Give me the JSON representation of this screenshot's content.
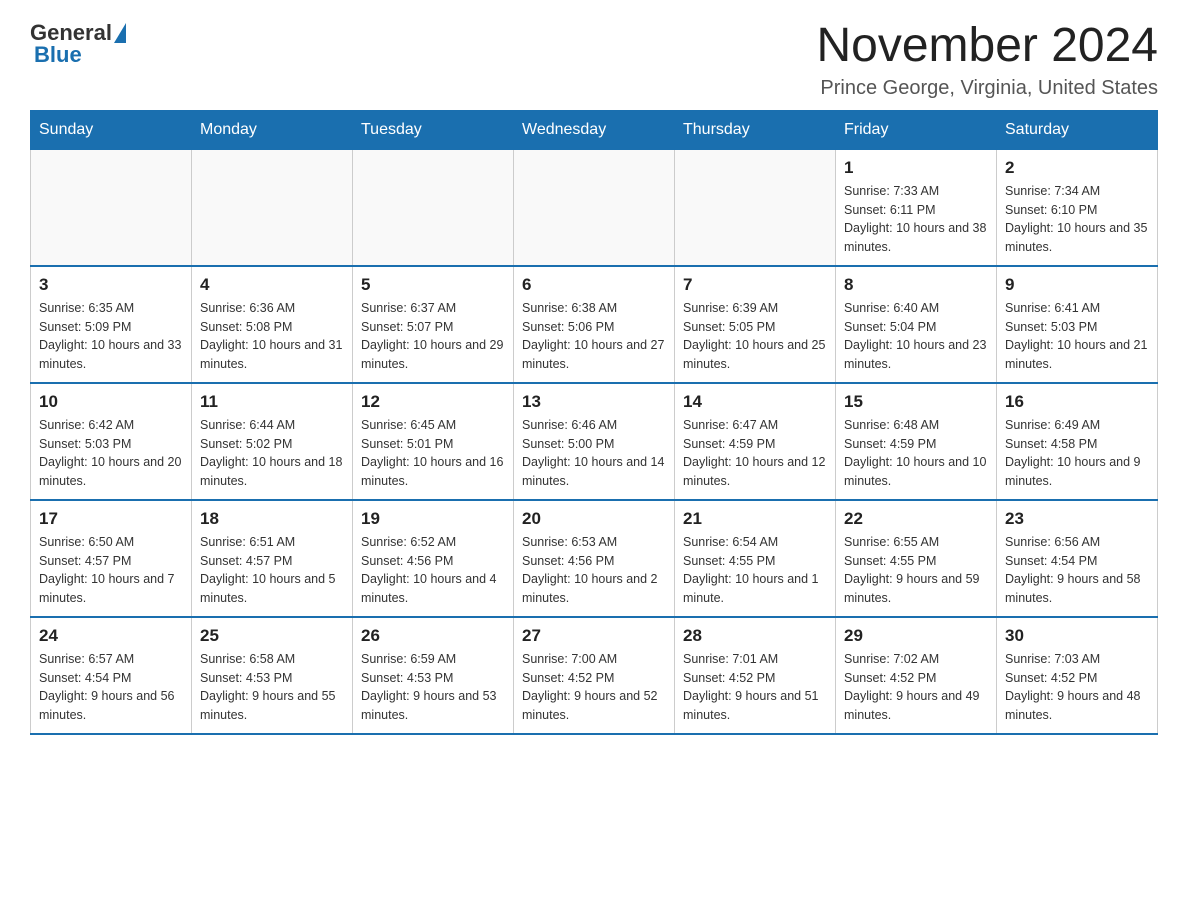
{
  "header": {
    "logo_general": "General",
    "logo_blue": "Blue",
    "month_title": "November 2024",
    "location": "Prince George, Virginia, United States"
  },
  "weekdays": [
    "Sunday",
    "Monday",
    "Tuesday",
    "Wednesday",
    "Thursday",
    "Friday",
    "Saturday"
  ],
  "weeks": [
    [
      {
        "day": "",
        "info": ""
      },
      {
        "day": "",
        "info": ""
      },
      {
        "day": "",
        "info": ""
      },
      {
        "day": "",
        "info": ""
      },
      {
        "day": "",
        "info": ""
      },
      {
        "day": "1",
        "info": "Sunrise: 7:33 AM\nSunset: 6:11 PM\nDaylight: 10 hours and 38 minutes."
      },
      {
        "day": "2",
        "info": "Sunrise: 7:34 AM\nSunset: 6:10 PM\nDaylight: 10 hours and 35 minutes."
      }
    ],
    [
      {
        "day": "3",
        "info": "Sunrise: 6:35 AM\nSunset: 5:09 PM\nDaylight: 10 hours and 33 minutes."
      },
      {
        "day": "4",
        "info": "Sunrise: 6:36 AM\nSunset: 5:08 PM\nDaylight: 10 hours and 31 minutes."
      },
      {
        "day": "5",
        "info": "Sunrise: 6:37 AM\nSunset: 5:07 PM\nDaylight: 10 hours and 29 minutes."
      },
      {
        "day": "6",
        "info": "Sunrise: 6:38 AM\nSunset: 5:06 PM\nDaylight: 10 hours and 27 minutes."
      },
      {
        "day": "7",
        "info": "Sunrise: 6:39 AM\nSunset: 5:05 PM\nDaylight: 10 hours and 25 minutes."
      },
      {
        "day": "8",
        "info": "Sunrise: 6:40 AM\nSunset: 5:04 PM\nDaylight: 10 hours and 23 minutes."
      },
      {
        "day": "9",
        "info": "Sunrise: 6:41 AM\nSunset: 5:03 PM\nDaylight: 10 hours and 21 minutes."
      }
    ],
    [
      {
        "day": "10",
        "info": "Sunrise: 6:42 AM\nSunset: 5:03 PM\nDaylight: 10 hours and 20 minutes."
      },
      {
        "day": "11",
        "info": "Sunrise: 6:44 AM\nSunset: 5:02 PM\nDaylight: 10 hours and 18 minutes."
      },
      {
        "day": "12",
        "info": "Sunrise: 6:45 AM\nSunset: 5:01 PM\nDaylight: 10 hours and 16 minutes."
      },
      {
        "day": "13",
        "info": "Sunrise: 6:46 AM\nSunset: 5:00 PM\nDaylight: 10 hours and 14 minutes."
      },
      {
        "day": "14",
        "info": "Sunrise: 6:47 AM\nSunset: 4:59 PM\nDaylight: 10 hours and 12 minutes."
      },
      {
        "day": "15",
        "info": "Sunrise: 6:48 AM\nSunset: 4:59 PM\nDaylight: 10 hours and 10 minutes."
      },
      {
        "day": "16",
        "info": "Sunrise: 6:49 AM\nSunset: 4:58 PM\nDaylight: 10 hours and 9 minutes."
      }
    ],
    [
      {
        "day": "17",
        "info": "Sunrise: 6:50 AM\nSunset: 4:57 PM\nDaylight: 10 hours and 7 minutes."
      },
      {
        "day": "18",
        "info": "Sunrise: 6:51 AM\nSunset: 4:57 PM\nDaylight: 10 hours and 5 minutes."
      },
      {
        "day": "19",
        "info": "Sunrise: 6:52 AM\nSunset: 4:56 PM\nDaylight: 10 hours and 4 minutes."
      },
      {
        "day": "20",
        "info": "Sunrise: 6:53 AM\nSunset: 4:56 PM\nDaylight: 10 hours and 2 minutes."
      },
      {
        "day": "21",
        "info": "Sunrise: 6:54 AM\nSunset: 4:55 PM\nDaylight: 10 hours and 1 minute."
      },
      {
        "day": "22",
        "info": "Sunrise: 6:55 AM\nSunset: 4:55 PM\nDaylight: 9 hours and 59 minutes."
      },
      {
        "day": "23",
        "info": "Sunrise: 6:56 AM\nSunset: 4:54 PM\nDaylight: 9 hours and 58 minutes."
      }
    ],
    [
      {
        "day": "24",
        "info": "Sunrise: 6:57 AM\nSunset: 4:54 PM\nDaylight: 9 hours and 56 minutes."
      },
      {
        "day": "25",
        "info": "Sunrise: 6:58 AM\nSunset: 4:53 PM\nDaylight: 9 hours and 55 minutes."
      },
      {
        "day": "26",
        "info": "Sunrise: 6:59 AM\nSunset: 4:53 PM\nDaylight: 9 hours and 53 minutes."
      },
      {
        "day": "27",
        "info": "Sunrise: 7:00 AM\nSunset: 4:52 PM\nDaylight: 9 hours and 52 minutes."
      },
      {
        "day": "28",
        "info": "Sunrise: 7:01 AM\nSunset: 4:52 PM\nDaylight: 9 hours and 51 minutes."
      },
      {
        "day": "29",
        "info": "Sunrise: 7:02 AM\nSunset: 4:52 PM\nDaylight: 9 hours and 49 minutes."
      },
      {
        "day": "30",
        "info": "Sunrise: 7:03 AM\nSunset: 4:52 PM\nDaylight: 9 hours and 48 minutes."
      }
    ]
  ]
}
